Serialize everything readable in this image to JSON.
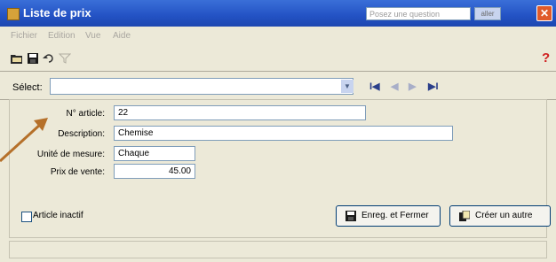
{
  "window": {
    "title": "Liste de prix",
    "close_glyph": "✕"
  },
  "help_box": {
    "placeholder": "Posez une question",
    "go_label": "aller"
  },
  "menu": [
    "Fichier",
    "Edition",
    "Vue",
    "Aide"
  ],
  "toolbar": {
    "help_glyph": "?",
    "icons": [
      "open-folder-icon",
      "save-icon",
      "undo-icon",
      "filter-icon"
    ]
  },
  "select": {
    "label": "Sélect:",
    "value": ""
  },
  "nav": {
    "first": "I◀",
    "prev": "◀",
    "next": "▶",
    "last": "▶I"
  },
  "form": {
    "article_no": {
      "label": "N° article:",
      "value": "22"
    },
    "description": {
      "label": "Description:",
      "value": "Chemise"
    },
    "unit": {
      "label": "Unité de mesure:",
      "value": "Chaque"
    },
    "price": {
      "label": "Prix de vente:",
      "value": "45.00"
    }
  },
  "inactive": {
    "label": "Article inactif",
    "checked": false
  },
  "buttons": {
    "save_close": "Enreg. et Fermer",
    "create_another": "Créer un autre"
  },
  "colors": {
    "titlebar": "#2352c4",
    "callout_arrow": "#b5702a",
    "window_bg": "#ece9d8"
  }
}
